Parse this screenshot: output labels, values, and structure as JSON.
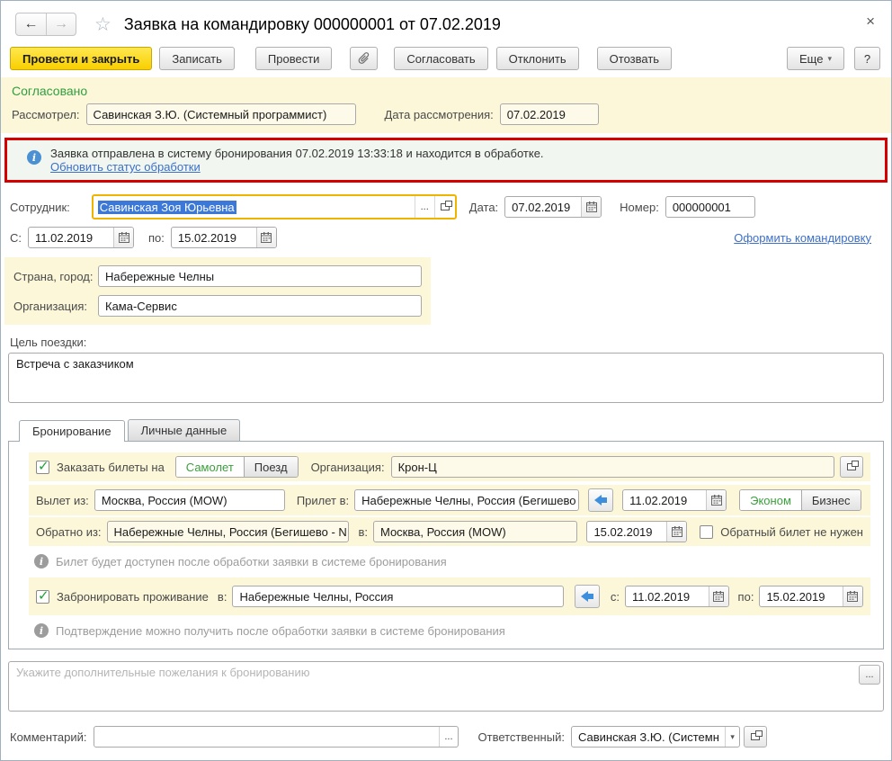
{
  "icons": {
    "back": "←",
    "forward": "→",
    "star": "☆",
    "close": "×",
    "more_caret": "▾",
    "dropdown_caret": "▾",
    "ellipsis": "...",
    "check": "✓",
    "info": "i"
  },
  "colors": {
    "primary_button_yellow": "#f9cf00",
    "panel_yellow": "#fcf7d9",
    "field_cream": "#fdfae9",
    "focus_border_gold": "#efb400",
    "alert_border_red": "#d60000",
    "approved_green": "#2f9e3f",
    "active_option_green": "#3ba03b",
    "link_blue": "#3c6fc8",
    "selection_blue": "#3b78d8",
    "info_icon_blue": "#4a90d2"
  },
  "window": {
    "title": "Заявка на командировку 000000001 от 07.02.2019"
  },
  "toolbar": {
    "post_close": "Провести и закрыть",
    "save": "Записать",
    "post": "Провести",
    "approve": "Согласовать",
    "decline": "Отклонить",
    "withdraw": "Отозвать",
    "more": "Еще",
    "help": "?"
  },
  "approval": {
    "status": "Согласовано",
    "reviewer_label": "Рассмотрел:",
    "reviewer": "Савинская З.Ю. (Системный программист)",
    "date_label": "Дата рассмотрения:",
    "date": "07.02.2019"
  },
  "notification": {
    "message": "Заявка отправлена в систему бронирования 07.02.2019 13:33:18 и находится в обработке.",
    "link": "Обновить статус обработки"
  },
  "request": {
    "employee_label": "Сотрудник:",
    "employee": "Савинская Зоя Юрьевна",
    "date_label": "Дата:",
    "date": "07.02.2019",
    "number_label": "Номер:",
    "number": "000000001",
    "period_from_label": "С:",
    "period_from": "11.02.2019",
    "period_to_label": "по:",
    "period_to": "15.02.2019",
    "trip_link": "Оформить командировку",
    "destination_label": "Страна, город:",
    "destination": "Набережные Челны",
    "organization_label": "Организация:",
    "organization": "Кама-Сервис",
    "purpose_label": "Цель поездки:",
    "purpose": "Встреча с заказчиком"
  },
  "tabs": {
    "booking": "Бронирование",
    "personal": "Личные данные"
  },
  "booking": {
    "order_tickets_label": "Заказать билеты на",
    "plane": "Самолет",
    "train": "Поезд",
    "organization_label": "Организация:",
    "organization": "Крон-Ц",
    "depart_from_label": "Вылет из:",
    "depart_from": "Москва, Россия (MOW)",
    "arrive_to_label": "Прилет в:",
    "arrive_to": "Набережные Челны, Россия (Бегишево",
    "depart_date": "11.02.2019",
    "economy": "Эконом",
    "business": "Бизнес",
    "return_from_label": "Обратно из:",
    "return_from": "Набережные Челны, Россия (Бегишево  - N",
    "return_to_label": "в:",
    "return_to": "Москва, Россия (MOW)",
    "return_date": "15.02.2019",
    "no_return_label": "Обратный билет не нужен",
    "ticket_note": "Билет будет доступен после обработки заявки в системе бронирования",
    "lodging_label": "Забронировать проживание",
    "lodging_in_label": "в:",
    "lodging_city": "Набережные Челны, Россия",
    "lodging_from_label": "с:",
    "lodging_from": "11.02.2019",
    "lodging_to_label": "по:",
    "lodging_to": "15.02.2019",
    "lodging_note": "Подтверждение можно получить после обработки заявки в системе бронирования",
    "wishes_placeholder": "Укажите дополнительные пожелания к бронированию"
  },
  "footer": {
    "comment_label": "Комментарий:",
    "responsible_label": "Ответственный:",
    "responsible": "Савинская З.Ю. (Системн"
  }
}
